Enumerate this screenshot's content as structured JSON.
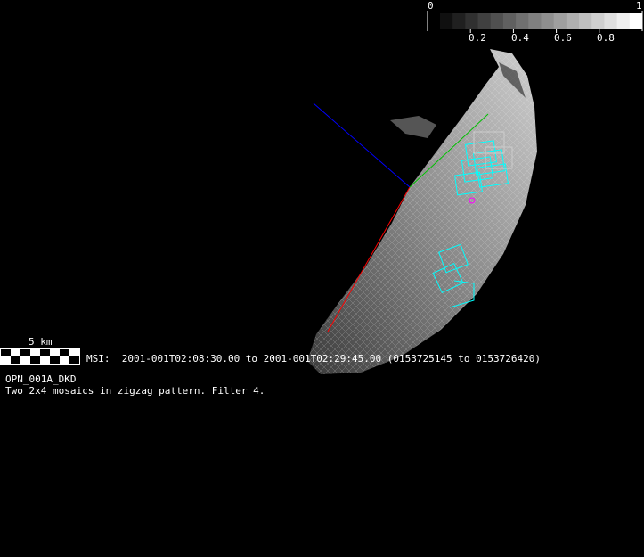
{
  "colorbar": {
    "min_label": "0",
    "max_label": "1",
    "tick_labels": [
      "0.2",
      "0.4",
      "0.6",
      "0.8"
    ],
    "ticks": [
      0.2,
      0.4,
      0.6,
      0.8
    ],
    "bins": 16
  },
  "scale_bar": {
    "label": "5 km"
  },
  "observation": {
    "line": "MSI:  2001-001T02:08:30.00 to 2001-001T02:29:45.00 (0153725145 to 0153726420)",
    "sequence_id": "OPN_001A_DKD",
    "description": "Two 2x4 mosaics in zigzag pattern. Filter 4."
  },
  "colors": {
    "background": "#000000",
    "footprint": "#00ffff",
    "axis_x": "#ff0000",
    "axis_y": "#00c000",
    "axis_z": "#0000ff",
    "marker": "#ff00ff"
  }
}
